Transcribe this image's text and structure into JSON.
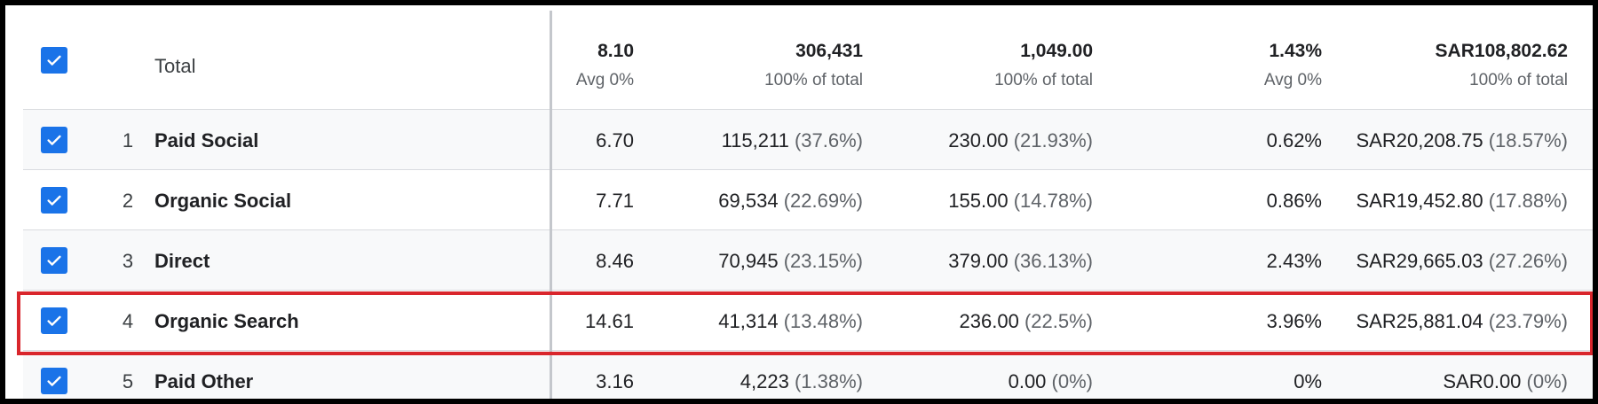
{
  "colors": {
    "checkbox": "#1a73e8",
    "highlight_border": "#d9262c",
    "frame_border": "#000000"
  },
  "table": {
    "total": {
      "label": "Total",
      "cols": [
        {
          "value": "8.10",
          "sub": "Avg 0%"
        },
        {
          "value": "306,431",
          "sub": "100% of total"
        },
        {
          "value": "1,049.00",
          "sub": "100% of total"
        },
        {
          "value": "1.43%",
          "sub": "Avg 0%"
        },
        {
          "value": "SAR108,802.62",
          "sub": "100% of total"
        }
      ]
    },
    "rows": [
      {
        "index": "1",
        "label": "Paid Social",
        "cols": [
          {
            "value": "6.70",
            "pct": ""
          },
          {
            "value": "115,211",
            "pct": "(37.6%)"
          },
          {
            "value": "230.00",
            "pct": "(21.93%)"
          },
          {
            "value": "0.62%",
            "pct": ""
          },
          {
            "value": "SAR20,208.75",
            "pct": "(18.57%)"
          }
        ]
      },
      {
        "index": "2",
        "label": "Organic Social",
        "cols": [
          {
            "value": "7.71",
            "pct": ""
          },
          {
            "value": "69,534",
            "pct": "(22.69%)"
          },
          {
            "value": "155.00",
            "pct": "(14.78%)"
          },
          {
            "value": "0.86%",
            "pct": ""
          },
          {
            "value": "SAR19,452.80",
            "pct": "(17.88%)"
          }
        ]
      },
      {
        "index": "3",
        "label": "Direct",
        "cols": [
          {
            "value": "8.46",
            "pct": ""
          },
          {
            "value": "70,945",
            "pct": "(23.15%)"
          },
          {
            "value": "379.00",
            "pct": "(36.13%)"
          },
          {
            "value": "2.43%",
            "pct": ""
          },
          {
            "value": "SAR29,665.03",
            "pct": "(27.26%)"
          }
        ]
      },
      {
        "index": "4",
        "label": "Organic Search",
        "cols": [
          {
            "value": "14.61",
            "pct": ""
          },
          {
            "value": "41,314",
            "pct": "(13.48%)"
          },
          {
            "value": "236.00",
            "pct": "(22.5%)"
          },
          {
            "value": "3.96%",
            "pct": ""
          },
          {
            "value": "SAR25,881.04",
            "pct": "(23.79%)"
          }
        ]
      },
      {
        "index": "5",
        "label": "Paid Other",
        "cols": [
          {
            "value": "3.16",
            "pct": ""
          },
          {
            "value": "4,223",
            "pct": "(1.38%)"
          },
          {
            "value": "0.00",
            "pct": "(0%)"
          },
          {
            "value": "0%",
            "pct": ""
          },
          {
            "value": "SAR0.00",
            "pct": "(0%)"
          }
        ]
      }
    ]
  }
}
